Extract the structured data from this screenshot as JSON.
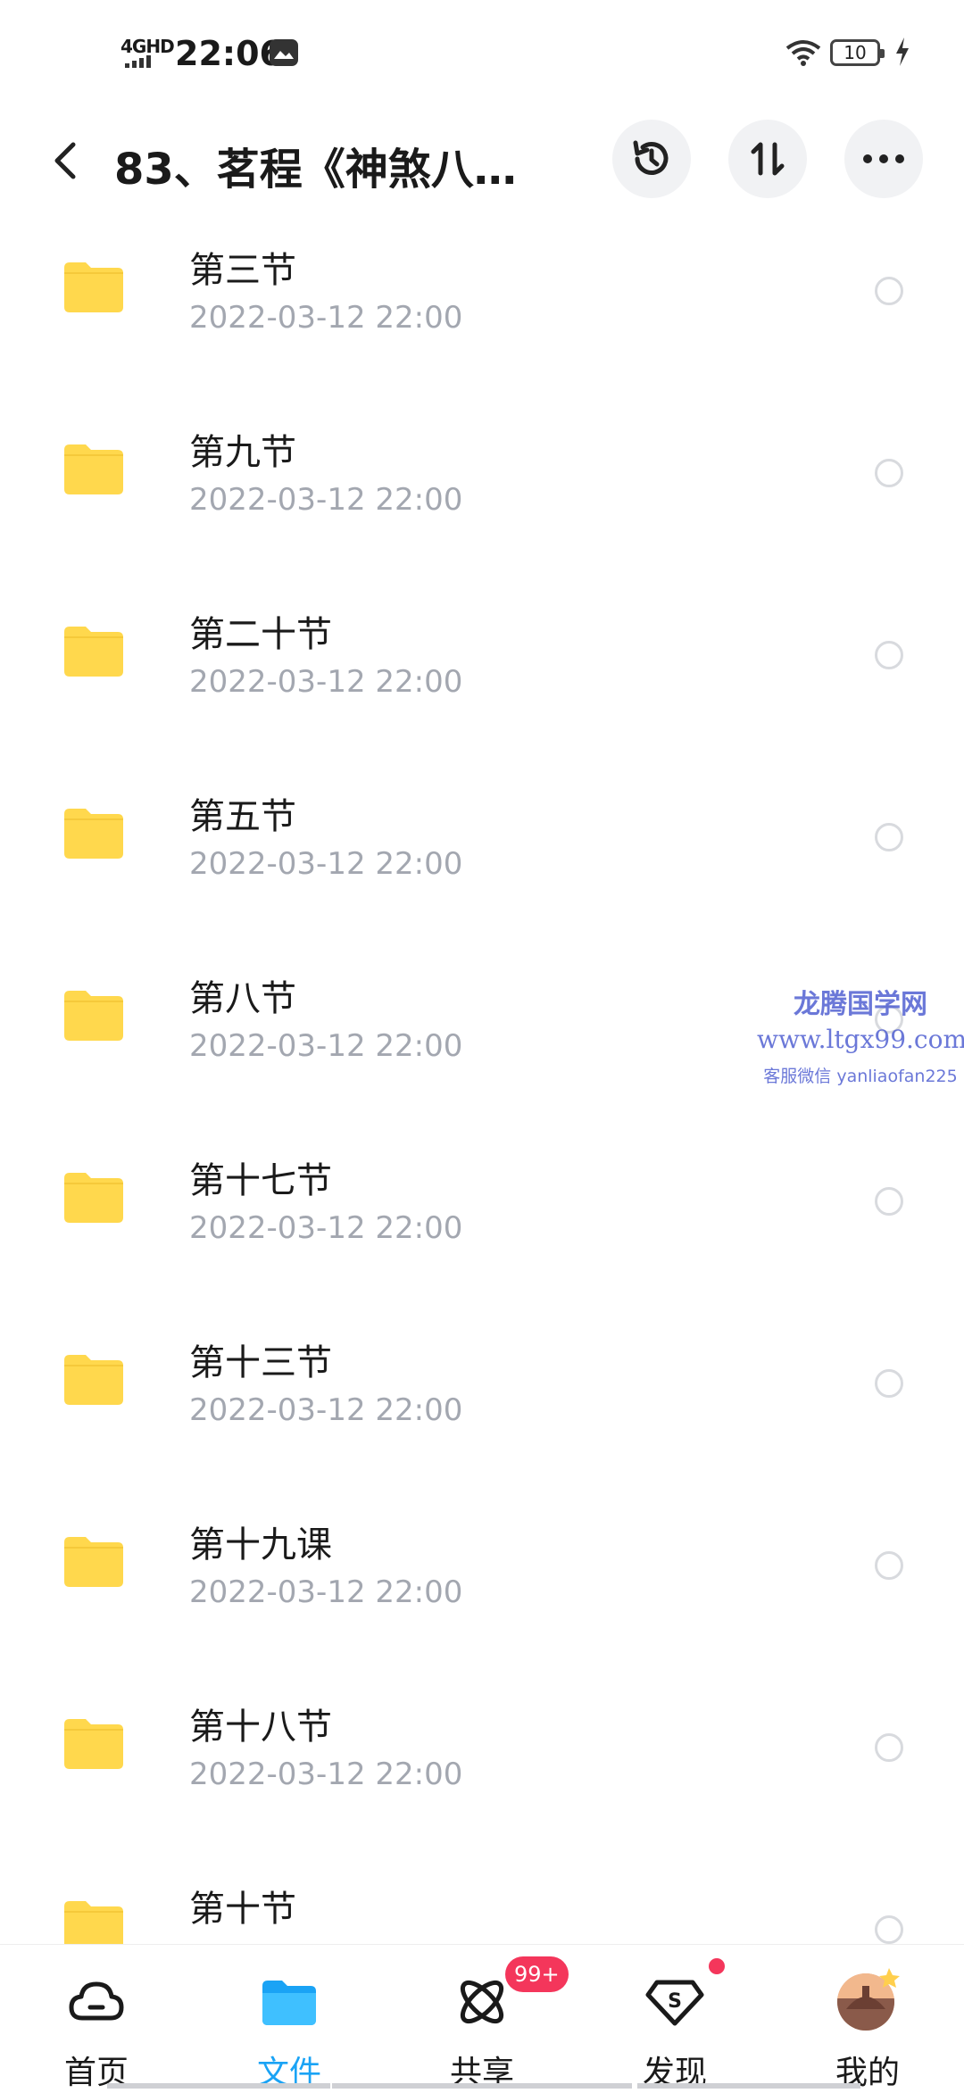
{
  "status_bar": {
    "network": "4GHD",
    "time": "22:06",
    "battery": "10"
  },
  "header": {
    "title": "83、茗程《神煞八…"
  },
  "files": [
    {
      "name": "第三节",
      "date": "2022-03-12  22:00"
    },
    {
      "name": "第九节",
      "date": "2022-03-12  22:00"
    },
    {
      "name": "第二十节",
      "date": "2022-03-12  22:00"
    },
    {
      "name": "第五节",
      "date": "2022-03-12  22:00"
    },
    {
      "name": "第八节",
      "date": "2022-03-12  22:00"
    },
    {
      "name": "第十七节",
      "date": "2022-03-12  22:00"
    },
    {
      "name": "第十三节",
      "date": "2022-03-12  22:00"
    },
    {
      "name": "第十九课",
      "date": "2022-03-12  22:00"
    },
    {
      "name": "第十八节",
      "date": "2022-03-12  22:00"
    },
    {
      "name": "第十节",
      "date": ""
    }
  ],
  "watermark": {
    "line1": "龙腾国学网",
    "line2": "www.ltgx99.com",
    "line3": "客服微信 yanliaofan225"
  },
  "bottom_nav": {
    "items": [
      {
        "label": "首页",
        "icon": "cloud-icon"
      },
      {
        "label": "文件",
        "icon": "folder-icon"
      },
      {
        "label": "共享",
        "icon": "share-orbit-icon"
      },
      {
        "label": "发现",
        "icon": "discover-diamond-icon"
      },
      {
        "label": "我的",
        "icon": "avatar-icon"
      }
    ],
    "active": "文件",
    "share_badge": "99+"
  },
  "colors": {
    "accent": "#1aa3f5",
    "folder": "#ffd84d",
    "badge": "#f4365b",
    "date_text": "#a3a7b0"
  }
}
